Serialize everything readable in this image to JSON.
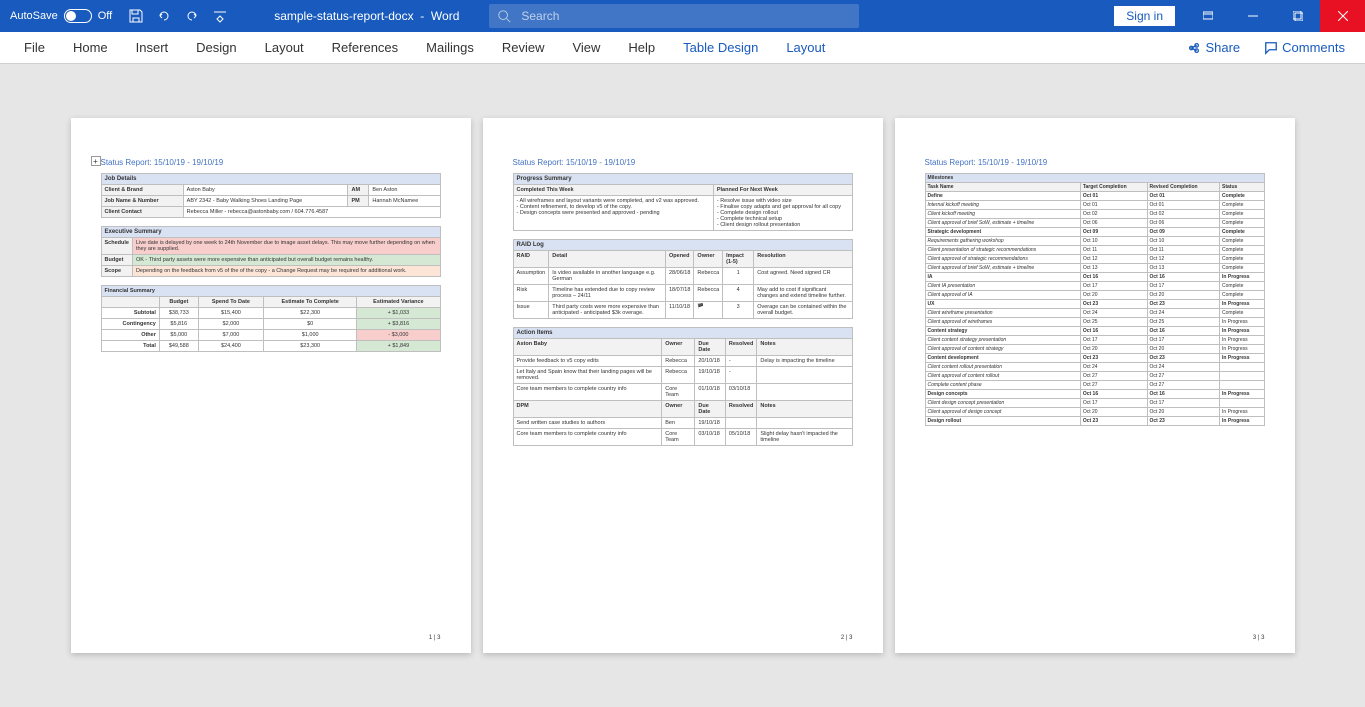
{
  "titlebar": {
    "autosave_label": "AutoSave",
    "autosave_state": "Off",
    "doc_name": "sample-status-report-docx",
    "app_name": "Word",
    "search_placeholder": "Search",
    "signin": "Sign in"
  },
  "ribbon": {
    "tabs": [
      "File",
      "Home",
      "Insert",
      "Design",
      "Layout",
      "References",
      "Mailings",
      "Review",
      "View",
      "Help"
    ],
    "context_tabs": [
      "Table Design",
      "Layout"
    ],
    "share": "Share",
    "comments": "Comments"
  },
  "report": {
    "title": "Status Report: 15/10/19 - 19/10/19",
    "page1_num": "1 | 3",
    "page2_num": "2 | 3",
    "page3_num": "3 | 3"
  },
  "job_details": {
    "header": "Job Details",
    "labels": {
      "client_brand": "Client & Brand",
      "am": "AM",
      "job_name_num": "Job Name & Number",
      "pm": "PM",
      "client_contact": "Client Contact"
    },
    "client_brand": "Aston Baby",
    "am": "Ben Aston",
    "job_name_num": "ABY 2342 - Baby Walking Shoes Landing Page",
    "pm": "Hannah McNamee",
    "client_contact": "Rebecca Miller - rebecca@astonbaby.com / 604.776.4587"
  },
  "exec_summary": {
    "header": "Executive Summary",
    "rows": [
      {
        "label": "Schedule",
        "text": "Live date is delayed by one week to 24th November due to image asset delays. This may move further depending on when they are supplied.",
        "cls": "red-bg"
      },
      {
        "label": "Budget",
        "text": "OK - Third party assets were more expensive than anticipated but overall budget remains healthy.",
        "cls": "green-bg"
      },
      {
        "label": "Scope",
        "text": "Depending on the feedback from v5 of the of the copy - a Change Request may be required for additional work.",
        "cls": "orange-bg"
      }
    ]
  },
  "financial": {
    "header": "Financial Summary",
    "cols": [
      "",
      "Budget",
      "Spend To Date",
      "Estimate To Complete",
      "Estimated Variance"
    ],
    "rows": [
      {
        "label": "Subtotal",
        "c": [
          "$38,733",
          "$15,400",
          "$22,300",
          "+ $1,033"
        ],
        "vcls": "green-bg"
      },
      {
        "label": "Contingency",
        "c": [
          "$5,816",
          "$2,000",
          "$0",
          "+ $3,816"
        ],
        "vcls": "green-bg"
      },
      {
        "label": "Other",
        "c": [
          "$5,000",
          "$7,000",
          "$1,000",
          "- $3,000"
        ],
        "vcls": "red-bg"
      },
      {
        "label": "Total",
        "c": [
          "$49,588",
          "$24,400",
          "$23,300",
          "+ $1,849"
        ],
        "vcls": "green-bg"
      }
    ]
  },
  "progress": {
    "header": "Progress Summary",
    "col1": "Completed This Week",
    "col2": "Planned For Next Week",
    "completed": "- All wireframes and layout variants were completed, and v2 was approved.\n- Content refinement, to develop v5 of the copy.\n- Design concepts were presented and approved - pending",
    "planned": "- Resolve issue with video size\n- Finalise copy adapts and get approval for all copy\n- Complete design rollout\n- Complete technical setup\n- Client design rollout presentation"
  },
  "raid": {
    "header": "RAID Log",
    "cols": [
      "RAID",
      "Detail",
      "Opened",
      "Owner",
      "Impact (1-5)",
      "Resolution"
    ],
    "rows": [
      {
        "c": [
          "Assumption",
          "Is video available in another language e.g. German",
          "28/06/18",
          "Rebecca",
          "1",
          "Cost agreed. Need signed CR"
        ]
      },
      {
        "c": [
          "Risk",
          "Timeline has extended due to copy review process – 24/11",
          "18/07/18",
          "Rebecca",
          "4",
          "May add to cost if significant changes and extend timeline further."
        ]
      },
      {
        "c": [
          "Issue",
          "Third party costs were more expensive than anticipated - anticipated $3k overage.",
          "11/10/18",
          "🏴",
          "3",
          "Overage can be contained within the overall budget."
        ]
      }
    ]
  },
  "actions": {
    "header": "Action Items",
    "cols": [
      "",
      "Owner",
      "Due Date",
      "Resolved",
      "Notes"
    ],
    "group1": "Aston Baby",
    "group1_rows": [
      {
        "c": [
          "Provide feedback to v5 copy edits",
          "Rebecca",
          "20/10/18",
          "-",
          "Delay is impacting the timeline"
        ]
      },
      {
        "c": [
          "Let Italy and Spain know that their landing pages will be removed.",
          "Rebecca",
          "19/10/18",
          "-",
          ""
        ]
      },
      {
        "c": [
          "Core team members to complete country info",
          "Core Team",
          "01/10/18",
          "03/10/18",
          ""
        ]
      }
    ],
    "group2": "DPM",
    "group2_rows": [
      {
        "c": [
          "Send written case studies to authors",
          "Ben",
          "19/10/18",
          "",
          ""
        ]
      },
      {
        "c": [
          "Core team members to complete country info",
          "Core Team",
          "03/10/18",
          "05/10/18",
          "Slight delay hasn't impacted the timeline"
        ]
      }
    ]
  },
  "milestones": {
    "header": "Milestones",
    "cols": [
      "Task Name",
      "Target Completion",
      "Revised Completion",
      "Status"
    ],
    "rows": [
      {
        "c": [
          "Define",
          "Oct 01",
          "Oct 01",
          "Complete"
        ],
        "b": true
      },
      {
        "c": [
          "Internal kickoff meeting",
          "Oct 01",
          "Oct 01",
          "Complete"
        ],
        "i": true
      },
      {
        "c": [
          "Client kickoff meeting",
          "Oct 02",
          "Oct 02",
          "Complete"
        ],
        "i": true
      },
      {
        "c": [
          "Client approval of brief SoW, estimate + timeline",
          "Oct 06",
          "Oct 06",
          "Complete"
        ],
        "i": true
      },
      {
        "c": [
          "Strategic development",
          "Oct 09",
          "Oct 09",
          "Complete"
        ],
        "b": true
      },
      {
        "c": [
          "Requirements gathering workshop",
          "Oct 10",
          "Oct 10",
          "Complete"
        ],
        "i": true
      },
      {
        "c": [
          "Client presentation of strategic recommendations",
          "Oct 11",
          "Oct 11",
          "Complete"
        ],
        "i": true
      },
      {
        "c": [
          "Client approval of strategic recommendations",
          "Oct 12",
          "Oct 12",
          "Complete"
        ],
        "i": true
      },
      {
        "c": [
          "Client approval of brief SoW, estimate + timeline",
          "Oct 13",
          "Oct 13",
          "Complete"
        ],
        "i": true
      },
      {
        "c": [
          "IA",
          "Oct 16",
          "Oct 16",
          "In Progress"
        ],
        "b": true
      },
      {
        "c": [
          "Client IA presentation",
          "Oct 17",
          "Oct 17",
          "Complete"
        ],
        "i": true
      },
      {
        "c": [
          "Client approval of IA",
          "Oct 20",
          "Oct 20",
          "Complete"
        ],
        "i": true
      },
      {
        "c": [
          "UX",
          "Oct 23",
          "Oct 23",
          "In Progress"
        ],
        "b": true
      },
      {
        "c": [
          "Client wireframe presentation",
          "Oct 24",
          "Oct 24",
          "Complete"
        ],
        "i": true
      },
      {
        "c": [
          "Client approval of wireframes",
          "Oct 25",
          "Oct 25",
          "In Progress"
        ],
        "i": true
      },
      {
        "c": [
          "Content strategy",
          "Oct 16",
          "Oct 16",
          "In Progress"
        ],
        "b": true
      },
      {
        "c": [
          "Client content strategy presentation",
          "Oct 17",
          "Oct 17",
          "In Progress"
        ],
        "i": true
      },
      {
        "c": [
          "Client approval of content strategy",
          "Oct 20",
          "Oct 20",
          "In Progress"
        ],
        "i": true
      },
      {
        "c": [
          "Content development",
          "Oct 23",
          "Oct 23",
          "In Progress"
        ],
        "b": true
      },
      {
        "c": [
          "Client content rollout presentation",
          "Oct 24",
          "Oct 24",
          ""
        ],
        "i": true
      },
      {
        "c": [
          "Client approval of content rollout",
          "Oct 27",
          "Oct 27",
          ""
        ],
        "i": true
      },
      {
        "c": [
          "Complete content phase",
          "Oct 27",
          "Oct 27",
          ""
        ],
        "i": true
      },
      {
        "c": [
          "Design concepts",
          "Oct 16",
          "Oct 16",
          "In Progress"
        ],
        "b": true
      },
      {
        "c": [
          "Client design concept presentation",
          "Oct 17",
          "Oct 17",
          ""
        ],
        "i": true
      },
      {
        "c": [
          "Client approval of design concept",
          "Oct 20",
          "Oct 20",
          "In Progress"
        ],
        "i": true
      },
      {
        "c": [
          "Design rollout",
          "Oct 23",
          "Oct 23",
          "In Progress"
        ],
        "b": true
      }
    ]
  }
}
